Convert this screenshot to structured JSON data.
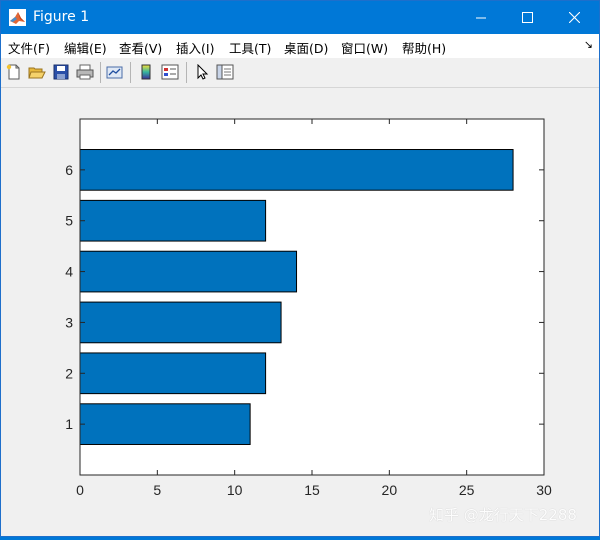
{
  "window": {
    "title": "Figure 1",
    "icon": "matlab-logo-icon",
    "controls": [
      "minimize-icon",
      "maximize-icon",
      "close-icon"
    ]
  },
  "menubar": {
    "items": [
      "文件(F)",
      "编辑(E)",
      "查看(V)",
      "插入(I)",
      "工具(T)",
      "桌面(D)",
      "窗口(W)",
      "帮助(H)"
    ],
    "dock_arrow": "↘"
  },
  "toolbar": {
    "buttons": [
      "new-figure-icon",
      "open-file-icon",
      "save-icon",
      "print-icon",
      "link-plot-icon",
      "insert-colorbar-icon",
      "insert-legend-icon",
      "edit-plot-arrow-icon",
      "property-inspector-icon"
    ]
  },
  "chart_data": {
    "type": "bar",
    "orientation": "horizontal",
    "categories": [
      "1",
      "2",
      "3",
      "4",
      "5",
      "6"
    ],
    "values": [
      11,
      12,
      13,
      14,
      12,
      28
    ],
    "xlim": [
      0,
      30
    ],
    "ylim": [
      0,
      7
    ],
    "xticks": [
      "0",
      "5",
      "10",
      "15",
      "20",
      "25",
      "30"
    ],
    "yticks": [
      "1",
      "2",
      "3",
      "4",
      "5",
      "6"
    ],
    "bar_color": "#0072bd",
    "edge_color": "#000000",
    "title": "",
    "xlabel": "",
    "ylabel": "",
    "grid": false
  },
  "watermark": "知乎 @龙行天下2288"
}
